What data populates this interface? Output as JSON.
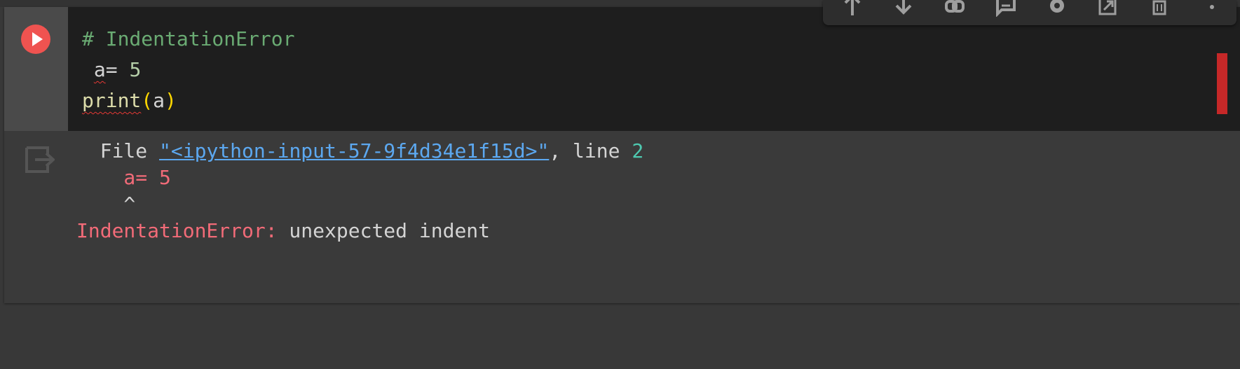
{
  "code_cell": {
    "line1_comment": "# IndentationError",
    "line2_indent": " ",
    "line2_var": "a",
    "line2_op": "= ",
    "line2_num": "5",
    "line3_fn": "print",
    "line3_open": "(",
    "line3_arg": "a",
    "line3_close": ")"
  },
  "output": {
    "file_prefix": "  File ",
    "file_link": "\"<ipython-input-57-9f4d34e1f15d>\"",
    "line_label": ", line ",
    "line_number": "2",
    "code_line": "    a= 5",
    "caret_line": "    ^",
    "error_name": "IndentationError:",
    "error_message": " unexpected indent"
  },
  "toolbar": {
    "icons": [
      "move-up-icon",
      "move-down-icon",
      "link-icon",
      "comment-icon",
      "settings-icon",
      "mirror-cell-icon",
      "delete-icon",
      "more-vert-icon"
    ]
  },
  "colors": {
    "run_button": "#ef5350",
    "error_text": "#f26b78",
    "link": "#5ca8f0",
    "comment": "#6aab73"
  }
}
